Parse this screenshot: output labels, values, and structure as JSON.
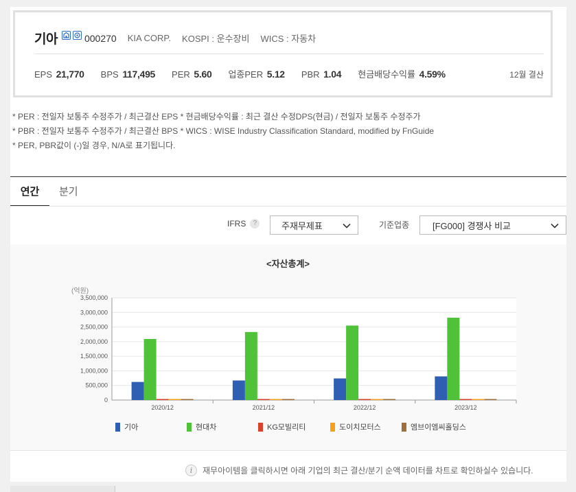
{
  "company": {
    "name": "기아",
    "code": "000270",
    "english_name": "KIA CORP.",
    "market": "KOSPI : 운수장비",
    "wics": "WICS : 자동차",
    "icons": [
      "building-icon",
      "flag-icon"
    ]
  },
  "metrics": [
    {
      "label": "EPS",
      "value": "21,770"
    },
    {
      "label": "BPS",
      "value": "117,495"
    },
    {
      "label": "PER",
      "value": "5.60"
    },
    {
      "label": "업종PER",
      "value": "5.12"
    },
    {
      "label": "PBR",
      "value": "1.04"
    },
    {
      "label": "현금배당수익률",
      "value": "4.59%"
    }
  ],
  "settlement": "12월 결산",
  "notes": [
    "* PER : 전일자 보통주 수정주가 / 최근결산 EPS * 현금배당수익률 : 최근 결산 수정DPS(현금) / 전일자 보통주 수정주가",
    "* PBR : 전일자 보통주 수정주가 / 최근결산 BPS * WICS : WISE Industry Classification Standard, modified by FnGuide",
    "* PER, PBR값이 (-)일 경우, N/A로 표기됩니다."
  ],
  "tabs": {
    "annual": "연간",
    "quarterly": "분기"
  },
  "filters": {
    "ifrs_label": "IFRS",
    "help_glyph": "?",
    "statement_select": "주재무제표",
    "standard_label": "기준업종",
    "standard_select": "[FG000] 경쟁사 비교"
  },
  "info_text": "재무아이템을 클릭하시면 아래 기업의 최근 결산/분기 순액 데이터를 차트로 확인하실수 있습니다.",
  "chart_data": {
    "type": "bar",
    "title": "<자산총계>",
    "ylabel": "(억원)",
    "ylim": [
      0,
      3500000
    ],
    "yticks": [
      "3,500,000",
      "3,000,000",
      "2,500,000",
      "2,000,000",
      "1,500,000",
      "1,000,000",
      "500,000",
      "0"
    ],
    "categories": [
      "2020/12",
      "2021/12",
      "2022/12",
      "2023/12"
    ],
    "series": [
      {
        "name": "기아",
        "color": "#2f5fb3",
        "values": [
          620000,
          670000,
          740000,
          810000
        ]
      },
      {
        "name": "현대차",
        "color": "#4fc23a",
        "values": [
          2090000,
          2330000,
          2550000,
          2820000
        ]
      },
      {
        "name": "KG모빌리티",
        "color": "#d9432b",
        "values": [
          19000,
          19000,
          20000,
          22000
        ]
      },
      {
        "name": "도이치모터스",
        "color": "#f5a11c",
        "values": [
          5000,
          6000,
          8000,
          10000
        ]
      },
      {
        "name": "엠브이엠씨홀딩스",
        "color": "#a0703c",
        "values": [
          4000,
          4000,
          4000,
          4000
        ]
      }
    ],
    "grid": true,
    "legend_position": "bottom"
  }
}
